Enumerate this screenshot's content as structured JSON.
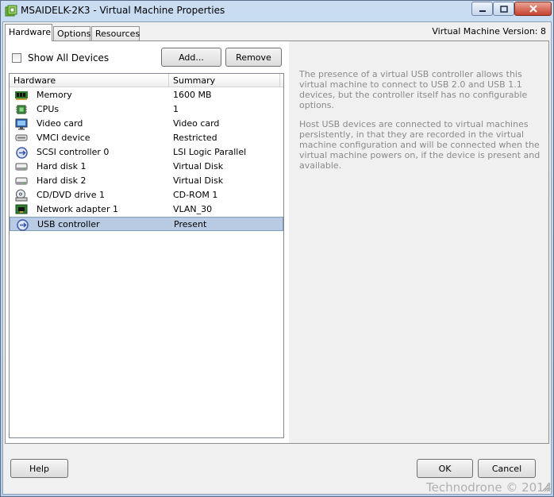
{
  "window": {
    "title": "MSAIDELK-2K3 - Virtual Machine Properties",
    "controls": [
      "minimize",
      "maximize",
      "close"
    ]
  },
  "tabs": [
    {
      "label": "Hardware",
      "active": true
    },
    {
      "label": "Options",
      "active": false
    },
    {
      "label": "Resources",
      "active": false
    }
  ],
  "vm_version": "Virtual Machine Version: 8",
  "toolbar": {
    "show_all_label": "Show All Devices",
    "show_all_checked": false,
    "add_label": "Add...",
    "remove_label": "Remove"
  },
  "table": {
    "columns": [
      "Hardware",
      "Summary"
    ],
    "rows": [
      {
        "name": "Memory",
        "summary": "1600 MB",
        "icon": "memory-icon"
      },
      {
        "name": "CPUs",
        "summary": "1",
        "icon": "cpu-icon"
      },
      {
        "name": "Video card",
        "summary": "Video card",
        "icon": "monitor-icon"
      },
      {
        "name": "VMCI device",
        "summary": "Restricted",
        "icon": "vmci-icon"
      },
      {
        "name": "SCSI controller 0",
        "summary": "LSI Logic Parallel",
        "icon": "scsi-icon"
      },
      {
        "name": "Hard disk 1",
        "summary": "Virtual Disk",
        "icon": "hard-disk-icon"
      },
      {
        "name": "Hard disk 2",
        "summary": "Virtual Disk",
        "icon": "hard-disk-icon"
      },
      {
        "name": "CD/DVD drive 1",
        "summary": "CD-ROM 1",
        "icon": "cd-drive-icon"
      },
      {
        "name": "Network adapter 1",
        "summary": "VLAN_30",
        "icon": "network-adapter-icon"
      },
      {
        "name": "USB controller",
        "summary": "Present",
        "icon": "usb-icon",
        "selected": true
      }
    ]
  },
  "info": {
    "paragraph1": "The presence of a virtual USB controller allows this virtual machine to connect to USB 2.0 and USB 1.1 devices,  but the controller itself has no configurable options.",
    "paragraph2": "Host USB devices are connected to virtual machines persistently, in that they are recorded in the virtual machine configuration and will be connected when the virtual machine powers on, if the device is present and available."
  },
  "footer": {
    "help_label": "Help",
    "ok_label": "OK",
    "cancel_label": "Cancel"
  },
  "watermark": "Technodrone © 2014",
  "colors": {
    "selection": "#b8cbe3",
    "info_text": "#8a8a8a",
    "frame": "#bcd3ec"
  }
}
